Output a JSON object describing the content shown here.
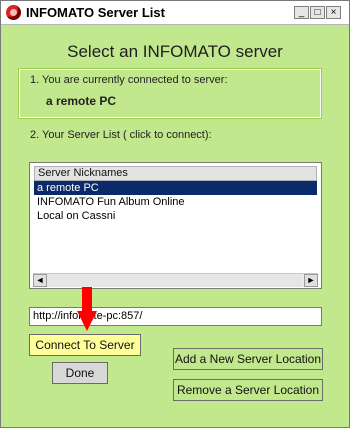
{
  "window": {
    "title": "INFOMATO Server List",
    "controls": {
      "minimize": "_",
      "maximize": "□",
      "close": "×"
    }
  },
  "heading": "Select an INFOMATO server",
  "current": {
    "label": "1. You are currently connected to server:",
    "value": "a remote PC"
  },
  "server_list": {
    "label": "2. Your Server List ( click to connect):",
    "column_header": "Server Nicknames",
    "items": [
      "a remote PC",
      "INFOMATO Fun Album Online",
      "Local on Cassni"
    ],
    "selected_index": 0,
    "scroll_left": "◄",
    "scroll_right": "►"
  },
  "url_field": {
    "value": "http://infomate-pc:857/"
  },
  "buttons": {
    "connect": "Connect To Server",
    "done": "Done",
    "add": "Add a New Server Location",
    "remove": "Remove a Server Location"
  },
  "colors": {
    "window_bg": "#c2e88e",
    "connect_bg": "#ffff99",
    "selection_bg": "#0a2a6a",
    "arrow": "#ff0000"
  },
  "annotation": {
    "icon": "red-down-arrow-icon"
  }
}
